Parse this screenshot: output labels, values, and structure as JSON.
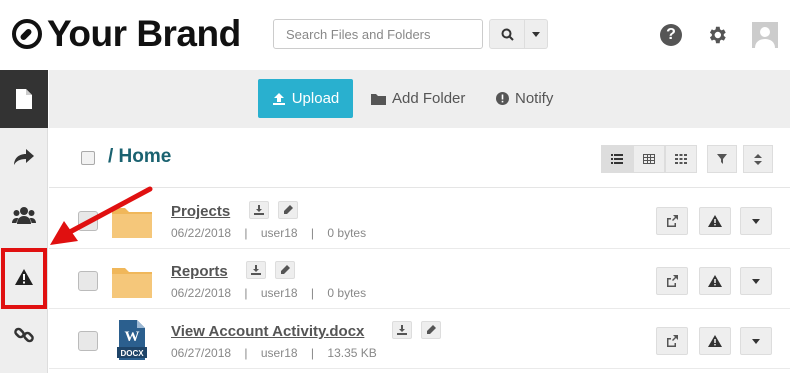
{
  "header": {
    "brand_name": "Your Brand",
    "search_placeholder": "Search Files and Folders"
  },
  "toolbar": {
    "upload_label": "Upload",
    "add_folder_label": "Add Folder",
    "notify_label": "Notify"
  },
  "breadcrumb": {
    "title": "/ Home"
  },
  "files": [
    {
      "name": "Projects",
      "type": "folder",
      "date": "06/22/2018",
      "owner": "user18",
      "size": "0 bytes"
    },
    {
      "name": "Reports",
      "type": "folder",
      "date": "06/22/2018",
      "owner": "user18",
      "size": "0 bytes"
    },
    {
      "name": "View Account Activity.docx",
      "type": "docx",
      "date": "06/27/2018",
      "owner": "user18",
      "size": "13.35 KB"
    }
  ],
  "meta_separator": "|",
  "colors": {
    "accent": "#29b0cf",
    "breadcrumb": "#1a6270",
    "highlight": "#e01010",
    "folder": "#f0b75a"
  },
  "icons": {
    "brand": "compass-icon",
    "help": "question-circle-icon",
    "settings": "gear-icon",
    "sidebar": [
      "file-icon",
      "share-icon",
      "users-icon",
      "warning-icon",
      "link-icon"
    ]
  }
}
